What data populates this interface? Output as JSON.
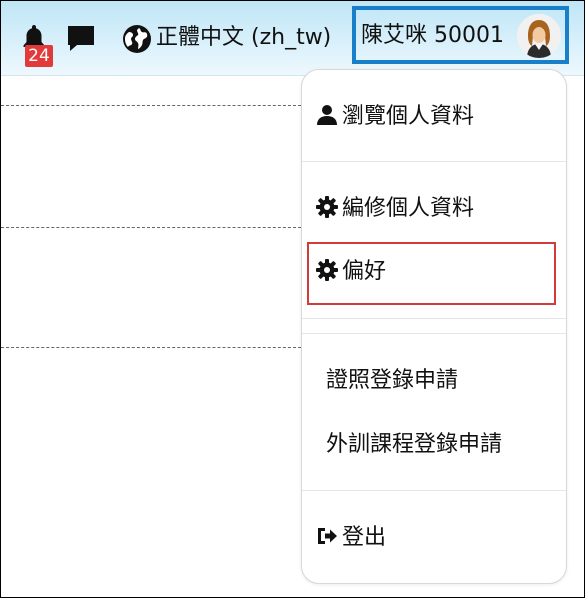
{
  "topbar": {
    "notifications": {
      "icon": "bell-icon",
      "count": "24"
    },
    "messages": {
      "icon": "chat-icon"
    },
    "language": {
      "icon": "globe-icon",
      "label": "正體中文 (zh_tw)"
    },
    "user": {
      "name": "陳艾咪 50001",
      "avatar": "avatar"
    }
  },
  "user_menu": {
    "items": [
      {
        "icon": "user-icon",
        "label": "瀏覽個人資料"
      },
      {
        "icon": "gear-icon",
        "label": "編修個人資料"
      },
      {
        "icon": "gear-icon",
        "label": "偏好"
      },
      {
        "icon": "",
        "label": "證照登錄申請"
      },
      {
        "icon": "",
        "label": "外訓課程登錄申請"
      },
      {
        "icon": "sign-out-icon",
        "label": "登出"
      }
    ]
  },
  "colors": {
    "topbar": "#cdeaf8",
    "user_outline": "#1a7fc9",
    "badge": "#e23a3a",
    "highlight": "#d23b3b"
  }
}
